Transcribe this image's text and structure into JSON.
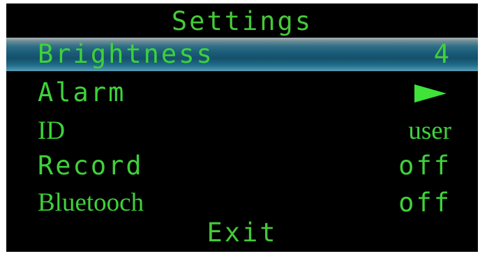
{
  "menu": {
    "title": "Settings",
    "items": [
      {
        "label": "Brightness",
        "value": "4",
        "selected": true
      },
      {
        "label": "Alarm",
        "value_icon": "play-arrow-icon"
      },
      {
        "label": "ID",
        "value": "user"
      },
      {
        "label": "Record",
        "value": "off"
      },
      {
        "label": "Bluetooch",
        "value": "off"
      }
    ],
    "exit_label": "Exit"
  },
  "colors": {
    "background": "#000000",
    "text": "#3fd13a",
    "highlight": "#1a5c78"
  }
}
